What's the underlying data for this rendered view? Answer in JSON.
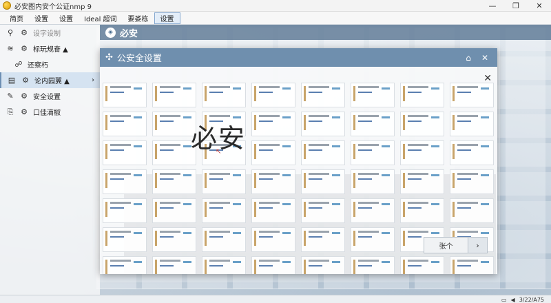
{
  "window": {
    "title": "必安图内安个公证nmp 9"
  },
  "menubar": [
    {
      "label": "简页"
    },
    {
      "label": "设置"
    },
    {
      "label": "设置"
    },
    {
      "label": "Ideal 超词"
    },
    {
      "label": "要娄栋"
    },
    {
      "label": "设置"
    }
  ],
  "sidebar": {
    "search_placeholder": "设字设制",
    "items": [
      {
        "label": "标玩规奋 ▲",
        "icon": "rows-icon"
      },
      {
        "label": "还察朽",
        "icon": "people-icon"
      },
      {
        "label": "论内园翼 ▲",
        "icon": "calendar-icon",
        "arrow": "›"
      },
      {
        "label": "安全设置",
        "icon": "wrench-icon"
      },
      {
        "label": "口佳滴椒",
        "icon": "export-icon"
      }
    ]
  },
  "main": {
    "title": "必安"
  },
  "dialog": {
    "title": "公安全设置",
    "big_text": "必安",
    "pager_label": "张个",
    "pager_next": "›"
  },
  "taskbar": {
    "clock": "3/22/A75"
  },
  "colors": {
    "header": "#6f8fae",
    "accent": "#5a7fb0"
  }
}
